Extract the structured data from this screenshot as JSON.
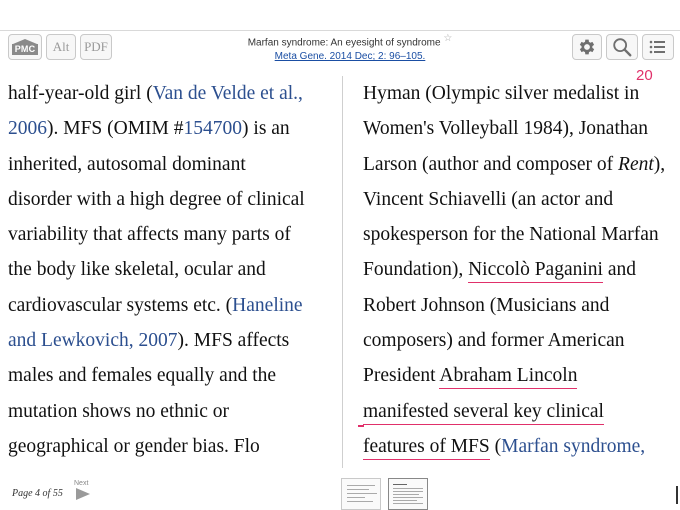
{
  "toolbar": {
    "pmc_label": "PMC",
    "alt_label": "Alt",
    "pdf_label": "PDF",
    "title": "Marfan syndrome: An eyesight of syndrome",
    "title_star": "☆",
    "citation": "Meta Gene. 2014 Dec; 2: 96–105.",
    "icons": [
      "gear-icon",
      "search-icon",
      "list-menu-icon"
    ]
  },
  "page_number": "20",
  "left_column": {
    "l1_a": "half-year-old girl (",
    "l1_link": "Van de Velde et al.,",
    "l2_link": "2006",
    "l2_b": "). MFS (OMIM #",
    "l2_link2": "154700",
    "l2_c": ") is an",
    "l3": "inherited, autosomal dominant",
    "l4": "disorder with a high degree of clinical",
    "l5": "variability that affects many parts of",
    "l6": "the body like skeletal, ocular and",
    "l7_a": "cardiovascular systems etc. (",
    "l7_link": "Haneline",
    "l8_link": "and Lewkovich, 2007",
    "l8_b": "). MFS affects",
    "l9": "males and females equally and the",
    "l10": "mutation shows no ethnic or",
    "l11": "geographical or gender bias. Flo"
  },
  "right_column": {
    "r1": "Hyman (Olympic silver medalist in",
    "r2": "Women's Volleyball 1984), Jonathan",
    "r3_a": "Larson (author and composer of ",
    "r3_em": "Rent",
    "r3_b": "),",
    "r4": "Vincent Schiavelli (an actor and",
    "r5": "spokesperson for the National Marfan",
    "r6_a": "Foundation), ",
    "r6_ul": "Niccolò Paganini",
    "r6_b": " and",
    "r7": "Robert Johnson (Musicians and",
    "r8": "composers) and former American",
    "r9_a": "President ",
    "r9_ul": "Abraham Lincoln",
    "r10_ul": "manifested several key clinical",
    "r11_ul": "features of MFS",
    "r11_b": " (",
    "r11_link": "Marfan syndrome,"
  },
  "footer": {
    "page_label": "Page 4 of 55",
    "next_label": "Next"
  },
  "colors": {
    "link": "#2c4f8f",
    "highlight": "#e0306a"
  }
}
